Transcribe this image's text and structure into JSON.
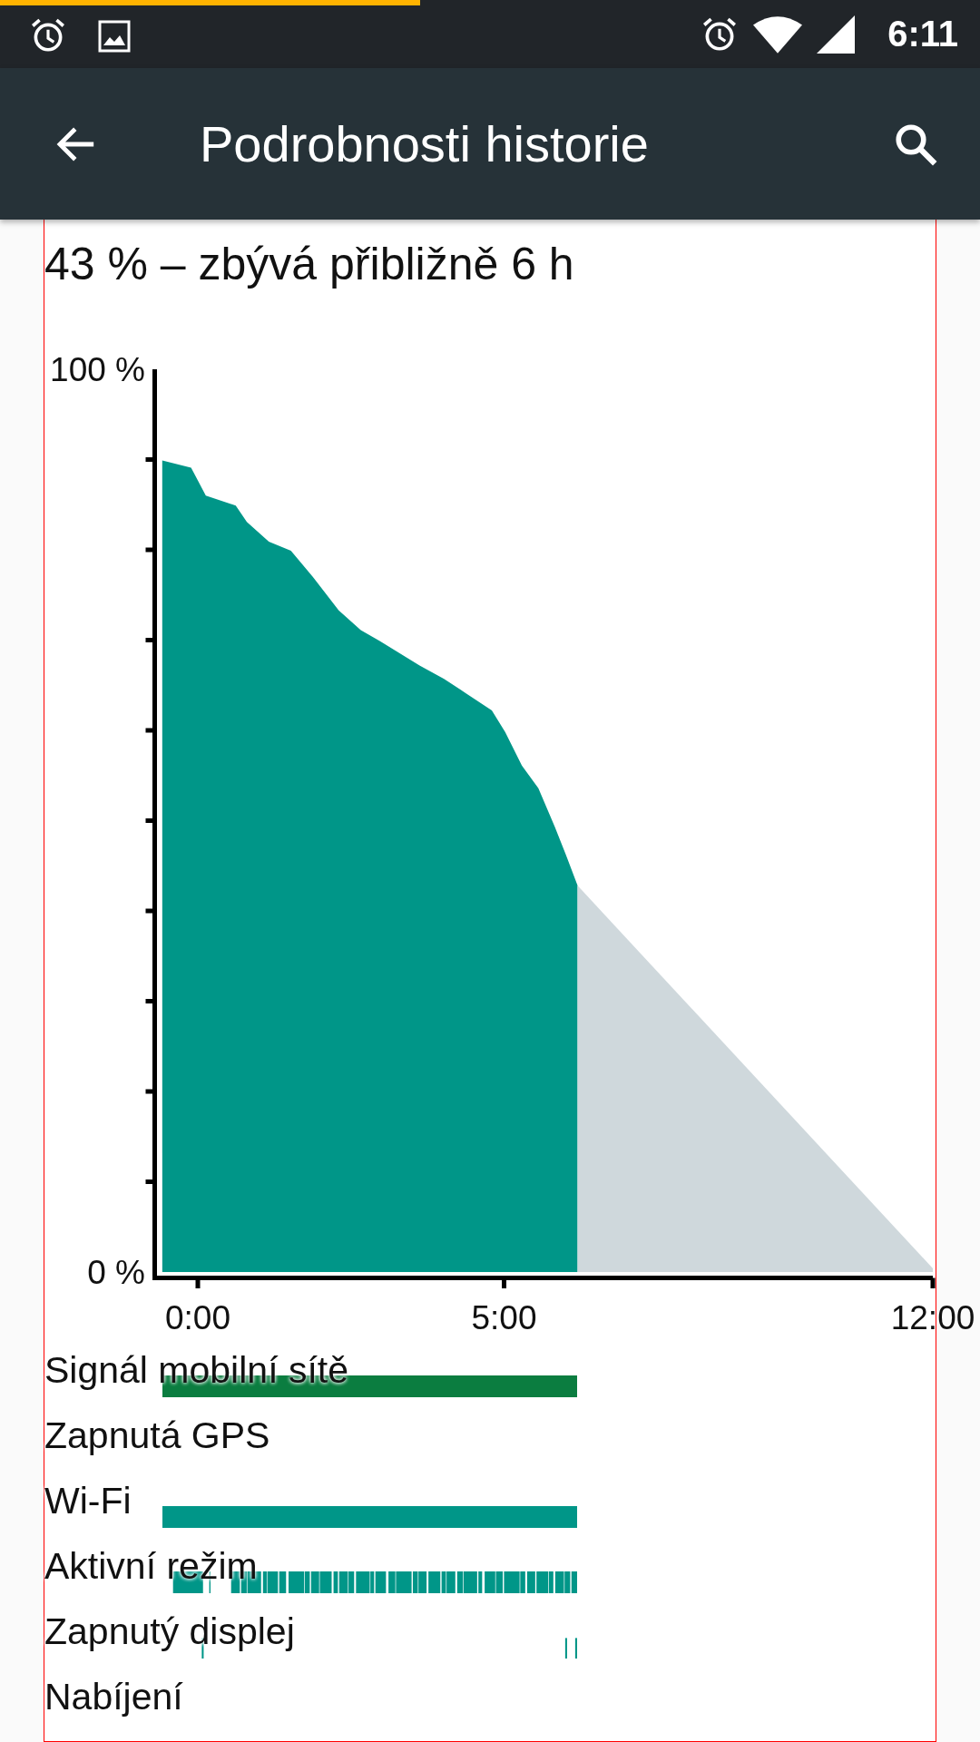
{
  "status_bar": {
    "time": "6:11"
  },
  "app_bar": {
    "title": "Podrobnosti historie"
  },
  "summary": "43 % – zbývá přibližně 6 h",
  "chart_data": {
    "type": "area",
    "xlim": [
      -0.74,
      12
    ],
    "ylim": [
      0,
      100
    ],
    "xticks": [
      {
        "value": 0,
        "label": "0:00"
      },
      {
        "value": 5,
        "label": "5:00"
      },
      {
        "value": 12,
        "label": "12:00"
      }
    ],
    "yticks": [
      {
        "value": 0,
        "label": "0 %"
      },
      {
        "value": 100,
        "label": "100 %"
      }
    ],
    "x": [
      -0.58,
      -0.11,
      0,
      0.13,
      0.62,
      0.8,
      1.16,
      1.52,
      1.88,
      2.3,
      2.66,
      2.97,
      3.62,
      4.02,
      4.38,
      4.8,
      5.02,
      5.29,
      5.56,
      5.83,
      6.01,
      6.2,
      12
    ],
    "series": [
      {
        "color": "#009688",
        "values": [
          89.9,
          89.1,
          87.7,
          86,
          84.9,
          83.1,
          80.9,
          79.9,
          77,
          73.3,
          71.1,
          69.9,
          67.2,
          65.7,
          64.1,
          62.2,
          59.8,
          56.1,
          53.6,
          49.3,
          46.2,
          42.8,
          null
        ]
      },
      {
        "color": "#cfd8dc",
        "values": [
          null,
          null,
          null,
          null,
          null,
          null,
          null,
          null,
          null,
          null,
          null,
          null,
          null,
          null,
          null,
          null,
          null,
          null,
          null,
          null,
          null,
          42.8,
          0.4
        ]
      }
    ]
  },
  "rows": [
    {
      "label": "Signál mobilní sítě",
      "kind": "solid",
      "color": "#0b7d40"
    },
    {
      "label": "Zapnutá GPS",
      "kind": "none"
    },
    {
      "label": "Wi-Fi",
      "kind": "solid",
      "color": "#009688"
    },
    {
      "label": "Aktivní režim",
      "kind": "stripes",
      "color": "#009688"
    },
    {
      "label": "Zapnutý displej",
      "kind": "ticks",
      "color": "#009688"
    },
    {
      "label": "Nabíjení",
      "kind": "none"
    }
  ]
}
